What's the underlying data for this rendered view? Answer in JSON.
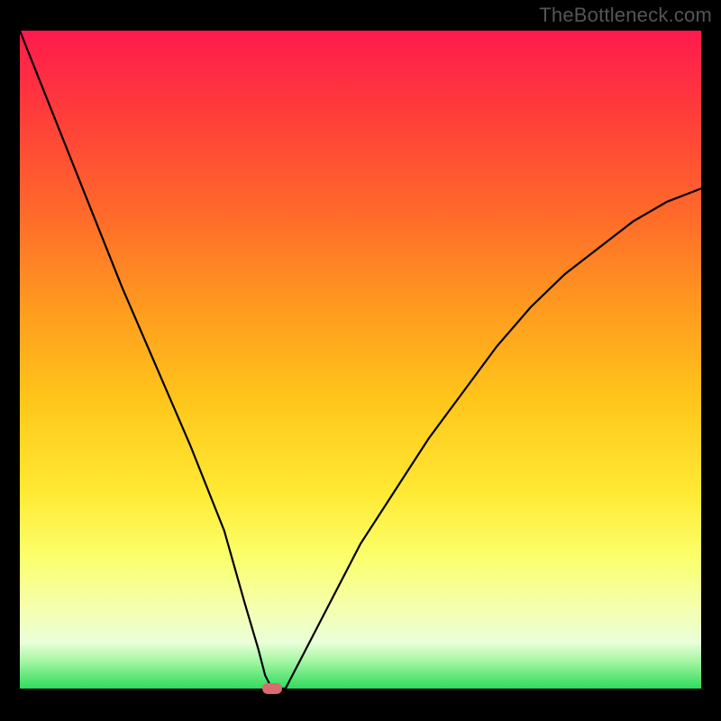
{
  "watermark": "TheBottleneck.com",
  "chart_data": {
    "type": "line",
    "title": "",
    "xlabel": "",
    "ylabel": "",
    "xlim": [
      0,
      100
    ],
    "ylim": [
      0,
      100
    ],
    "grid": false,
    "watermark": "TheBottleneck.com",
    "background_gradient": {
      "top": "#ff1a4d",
      "mid": "#ffe933",
      "bottom": "#2edb5e"
    },
    "series": [
      {
        "name": "bottleneck-curve",
        "color": "#000000",
        "x": [
          0,
          5,
          10,
          15,
          20,
          25,
          30,
          33,
          35,
          36,
          37,
          38,
          39,
          40,
          42,
          45,
          50,
          55,
          60,
          65,
          70,
          75,
          80,
          85,
          90,
          95,
          100
        ],
        "y": [
          100,
          87,
          74,
          61,
          49,
          37,
          24,
          13,
          6,
          2,
          0,
          0,
          0,
          2,
          6,
          12,
          22,
          30,
          38,
          45,
          52,
          58,
          63,
          67,
          71,
          74,
          76
        ]
      }
    ],
    "marker": {
      "x": 37,
      "y": 0,
      "color": "#d96a6e"
    }
  }
}
